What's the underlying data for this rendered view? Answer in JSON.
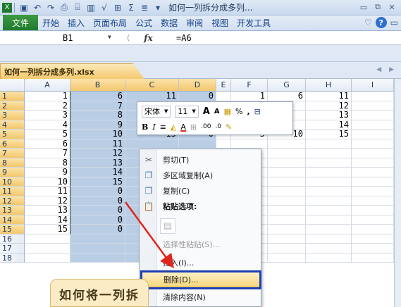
{
  "window": {
    "title": "如何一列拆分成多列...",
    "quick_access": [
      "excel-logo-icon",
      "save-icon",
      "undo-icon",
      "redo-icon",
      "print-preview-icon",
      "format-painter-icon",
      "chart-icon",
      "sqrt-icon",
      "table-icon",
      "sum-icon",
      "sort-icon",
      "customize-icon"
    ],
    "controls": [
      "minimize-icon",
      "restore-icon",
      "close-icon"
    ]
  },
  "ribbon": {
    "tabs": [
      "文件",
      "开始",
      "插入",
      "页面布局",
      "公式",
      "数据",
      "审阅",
      "视图",
      "开发工具"
    ],
    "active_tab": "文件"
  },
  "formula_bar": {
    "name_box": "B1",
    "fx_label": "fx",
    "formula": "=A6"
  },
  "sheet": {
    "tab_name": "如何一列拆分成多列.xlsx",
    "columns": [
      "A",
      "B",
      "C",
      "D",
      "E",
      "F",
      "G",
      "H",
      "I"
    ],
    "selected_columns": [
      "B",
      "C",
      "D"
    ],
    "rows": [
      {
        "num": "1",
        "A": "1",
        "B": "6",
        "C": "11",
        "D": "0",
        "F": "1",
        "G": "6",
        "H": "11"
      },
      {
        "num": "2",
        "A": "2",
        "B": "7",
        "C": "12",
        "D": "",
        "F": "",
        "G": "",
        "H": "12"
      },
      {
        "num": "3",
        "A": "3",
        "B": "8",
        "C": "",
        "D": "",
        "F": "",
        "G": "",
        "H": "13"
      },
      {
        "num": "4",
        "A": "4",
        "B": "9",
        "C": "",
        "D": "",
        "F": "",
        "G": "",
        "H": "14"
      },
      {
        "num": "5",
        "A": "5",
        "B": "10",
        "C": "15",
        "D": "0",
        "F": "5",
        "G": "10",
        "H": "15"
      },
      {
        "num": "6",
        "A": "6",
        "B": "11",
        "C": "",
        "D": "",
        "F": "",
        "G": "",
        "H": ""
      },
      {
        "num": "7",
        "A": "7",
        "B": "12",
        "C": "",
        "D": "",
        "F": "",
        "G": "",
        "H": ""
      },
      {
        "num": "8",
        "A": "8",
        "B": "13",
        "C": "",
        "D": "",
        "F": "",
        "G": "",
        "H": ""
      },
      {
        "num": "9",
        "A": "9",
        "B": "14",
        "C": "",
        "D": "",
        "F": "",
        "G": "",
        "H": ""
      },
      {
        "num": "10",
        "A": "10",
        "B": "15",
        "C": "",
        "D": "",
        "F": "",
        "G": "",
        "H": ""
      },
      {
        "num": "11",
        "A": "11",
        "B": "0",
        "C": "",
        "D": "",
        "F": "",
        "G": "",
        "H": ""
      },
      {
        "num": "12",
        "A": "12",
        "B": "0",
        "C": "",
        "D": "",
        "F": "",
        "G": "",
        "H": ""
      },
      {
        "num": "13",
        "A": "13",
        "B": "0",
        "C": "",
        "D": "",
        "F": "",
        "G": "",
        "H": ""
      },
      {
        "num": "14",
        "A": "14",
        "B": "0",
        "C": "",
        "D": "",
        "F": "",
        "G": "",
        "H": ""
      },
      {
        "num": "15",
        "A": "15",
        "B": "0",
        "C": "",
        "D": "",
        "F": "",
        "G": "",
        "H": ""
      },
      {
        "num": "16",
        "A": "",
        "B": "",
        "C": "",
        "D": "",
        "F": "",
        "G": "",
        "H": ""
      },
      {
        "num": "17",
        "A": "",
        "B": "",
        "C": "",
        "D": "",
        "F": "",
        "G": "",
        "H": ""
      },
      {
        "num": "18",
        "A": "",
        "B": "",
        "C": "",
        "D": "",
        "F": "",
        "G": "",
        "H": ""
      }
    ]
  },
  "mini_toolbar": {
    "font": "宋体",
    "size": "11",
    "row1_extra": [
      "A",
      "A",
      "%",
      ","
    ],
    "row2": [
      "B",
      "I",
      "≡",
      "A",
      ".00",
      ".0"
    ]
  },
  "context_menu": {
    "items": [
      {
        "label": "剪切(T)",
        "icon": "cut-icon"
      },
      {
        "label": "多区域复制(A)",
        "icon": "copy-icon"
      },
      {
        "label": "复制(C)",
        "icon": "copy-icon"
      },
      {
        "label": "粘贴选项:",
        "icon": "paste-icon"
      },
      {
        "label": "",
        "icon": "paste-option-icon"
      },
      {
        "label": "选择性粘贴(S)...",
        "icon": ""
      },
      {
        "label": "插入(I)...",
        "icon": ""
      },
      {
        "label": "删除(D)...",
        "icon": ""
      },
      {
        "label": "清除内容(N)",
        "icon": ""
      }
    ],
    "highlighted": "删除(D)..."
  },
  "callout": {
    "text": "如何将一列拆"
  },
  "colors": {
    "selection": "#b9cde5",
    "highlight_border": "#1d3fb4",
    "arrow": "#e0261c",
    "file_tab": "#1f7a2c",
    "sheet_tab": "#f5c96f"
  }
}
